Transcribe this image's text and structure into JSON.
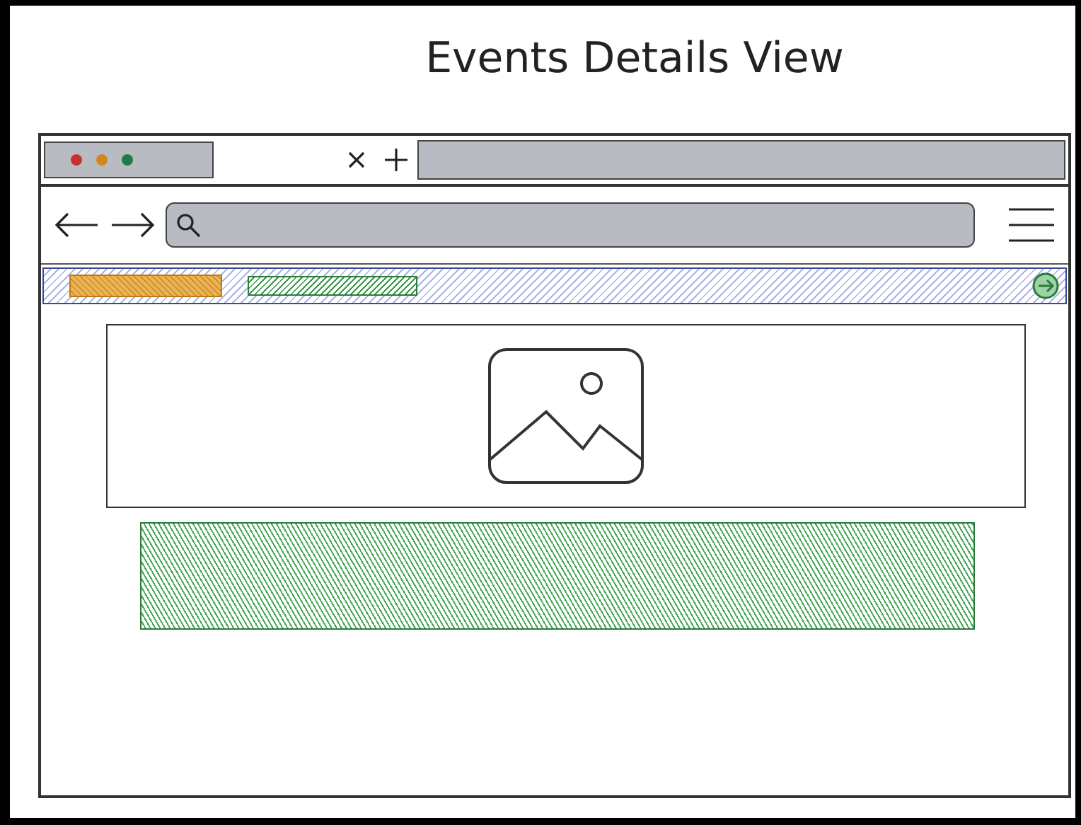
{
  "title": "Events Details View",
  "browser": {
    "window_dots": [
      {
        "color": "#c8302c"
      },
      {
        "color": "#d4861c"
      },
      {
        "color": "#1f7a4a"
      }
    ]
  }
}
